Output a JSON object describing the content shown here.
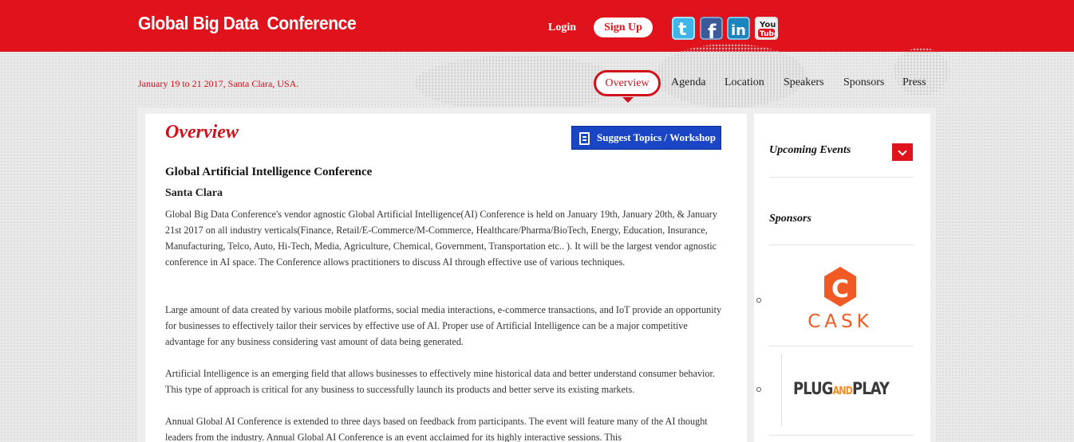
{
  "header": {
    "brand": "Global Big Data  Conference",
    "login_label": "Login",
    "signup_label": "Sign Up",
    "social": [
      "twitter-icon",
      "facebook-icon",
      "linkedin-icon",
      "youtube-icon"
    ],
    "youtube_text_top": "You",
    "youtube_text_bottom": "Tube"
  },
  "event_info": {
    "date_location": "January 19 to 21 2017, Santa Clara, USA."
  },
  "nav": {
    "items": [
      "Overview",
      "Agenda",
      "Location",
      "Speakers",
      "Sponsors",
      "Press"
    ],
    "active": "Overview"
  },
  "main": {
    "heading": "Overview",
    "suggest_button": "Suggest Topics / Workshop",
    "conference_title": "Global Artificial Intelligence Conference",
    "city": "Santa Clara",
    "paragraphs": [
      "Global Big Data Conference's vendor agnostic Global Artificial Intelligence(AI) Conference is held on January 19th, January 20th, & January 21st 2017 on all industry verticals(Finance, Retail/E-Commerce/M-Commerce, Healthcare/Pharma/BioTech, Energy, Education, Insurance, Manufacturing, Telco, Auto, Hi-Tech, Media, Agriculture, Chemical, Government, Transportation etc.. ). It will be the largest vendor agnostic conference in AI space. The Conference allows practitioners to discuss AI through effective use of various techniques.",
      "Large amount of data created by various mobile platforms, social media interactions, e-commerce transactions, and IoT provide an opportunity for businesses to effectively tailor their services by effective use of AI. Proper use of Artificial Intelligence can be a major competitive advantage for any business considering vast amount of  data being generated.",
      "Artificial Intelligence is an emerging field that allows businesses to effectively mine historical data and better understand consumer behavior. This type of approach is critical for any business to successfully launch its products and better serve its existing markets.",
      "Annual Global AI Conference is extended to three days based on feedback from participants. The event will feature many of the AI thought leaders from the industry. Annual Global AI Conference is an event acclaimed for its highly interactive sessions. This"
    ]
  },
  "sidebar": {
    "upcoming_events": "Upcoming Events",
    "sponsors_heading": "Sponsors",
    "sponsors": [
      {
        "name": "CASK",
        "logo_letter": "C"
      },
      {
        "name_parts": [
          "PLUG",
          "AND",
          "PLAY"
        ]
      }
    ]
  },
  "colors": {
    "brand_red": "#e0121c",
    "button_blue": "#1a45c5",
    "cask_orange": "#f05a24"
  }
}
